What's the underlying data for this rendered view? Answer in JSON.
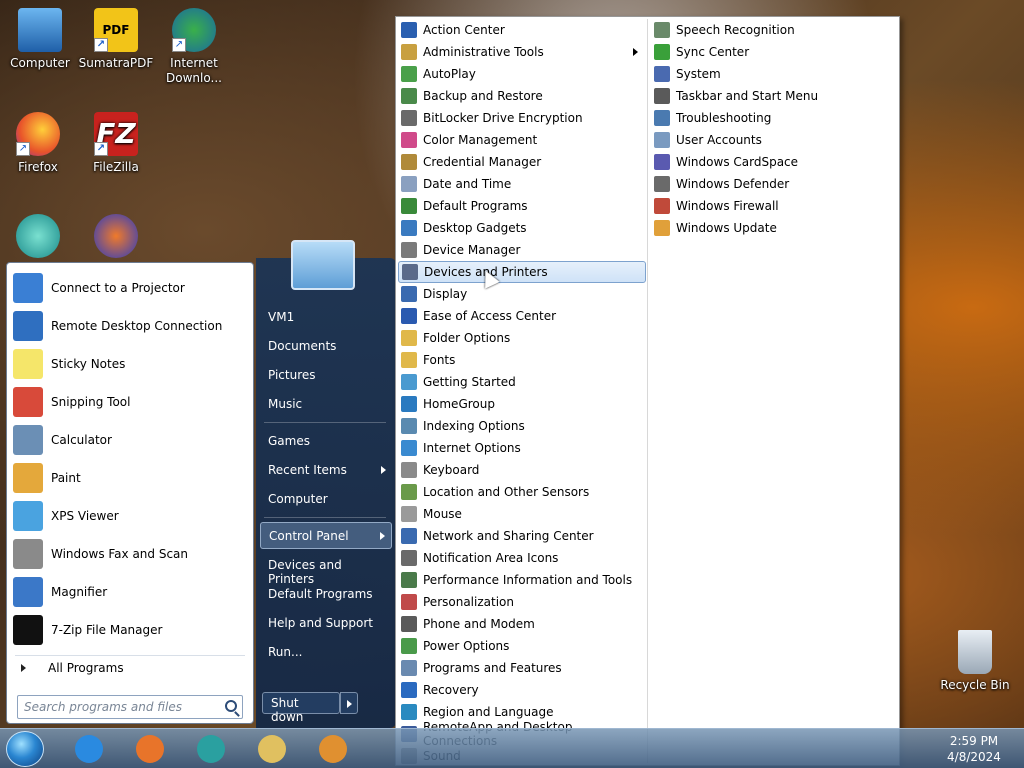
{
  "desktop": {
    "icons": [
      {
        "label": "Computer",
        "icon": "computer-icon"
      },
      {
        "label": "SumatraPDF",
        "icon": "pdf-icon"
      },
      {
        "label": "Internet Downlo...",
        "icon": "download-manager-icon"
      },
      {
        "label": "Firefox",
        "icon": "firefox-icon"
      },
      {
        "label": "FileZilla",
        "icon": "filezilla-icon"
      },
      {
        "label": "",
        "icon": "app-icon"
      },
      {
        "label": "",
        "icon": "audio-icon"
      },
      {
        "label": "Recycle Bin",
        "icon": "recycle-bin-icon"
      }
    ]
  },
  "start_menu": {
    "programs": [
      {
        "label": "Connect to a Projector",
        "icon": "projector-icon",
        "color": "#3a7fd4"
      },
      {
        "label": "Remote Desktop Connection",
        "icon": "remote-desktop-icon",
        "color": "#2f6fc0"
      },
      {
        "label": "Sticky Notes",
        "icon": "sticky-notes-icon",
        "color": "#f5e66a"
      },
      {
        "label": "Snipping Tool",
        "icon": "snipping-tool-icon",
        "color": "#d84a3a"
      },
      {
        "label": "Calculator",
        "icon": "calculator-icon",
        "color": "#6b8fb5"
      },
      {
        "label": "Paint",
        "icon": "paint-icon",
        "color": "#e4a83b"
      },
      {
        "label": "XPS Viewer",
        "icon": "xps-viewer-icon",
        "color": "#4aa3e0"
      },
      {
        "label": "Windows Fax and Scan",
        "icon": "fax-scan-icon",
        "color": "#8a8a8a"
      },
      {
        "label": "Magnifier",
        "icon": "magnifier-icon",
        "color": "#3b78c8"
      },
      {
        "label": "7-Zip File Manager",
        "icon": "7zip-icon",
        "color": "#111111"
      }
    ],
    "all_programs": "All Programs",
    "search_placeholder": "Search programs and files",
    "places": [
      {
        "label": "VM1",
        "submenu": false
      },
      {
        "label": "Documents",
        "submenu": false
      },
      {
        "label": "Pictures",
        "submenu": false
      },
      {
        "label": "Music",
        "submenu": false
      },
      {
        "label": "Games",
        "submenu": false
      },
      {
        "label": "Recent Items",
        "submenu": true
      },
      {
        "label": "Computer",
        "submenu": false
      },
      {
        "label": "Control Panel",
        "submenu": true,
        "highlighted": true
      },
      {
        "label": "Devices and Printers",
        "submenu": false
      },
      {
        "label": "Default Programs",
        "submenu": false
      },
      {
        "label": "Help and Support",
        "submenu": false
      },
      {
        "label": "Run...",
        "submenu": false
      }
    ],
    "shutdown": "Shut down"
  },
  "control_panel_menu": {
    "column1": [
      {
        "label": "Action Center",
        "color": "#2a5fb0"
      },
      {
        "label": "Administrative Tools",
        "color": "#c8a040",
        "submenu": true
      },
      {
        "label": "AutoPlay",
        "color": "#4aa04a"
      },
      {
        "label": "Backup and Restore",
        "color": "#4a8a4a"
      },
      {
        "label": "BitLocker Drive Encryption",
        "color": "#6a6a6a"
      },
      {
        "label": "Color Management",
        "color": "#d04a8a"
      },
      {
        "label": "Credential Manager",
        "color": "#b08a3a"
      },
      {
        "label": "Date and Time",
        "color": "#8aa0c0"
      },
      {
        "label": "Default Programs",
        "color": "#3a8a3a"
      },
      {
        "label": "Desktop Gadgets",
        "color": "#3a7ac0"
      },
      {
        "label": "Device Manager",
        "color": "#7a7a7a"
      },
      {
        "label": "Devices and Printers",
        "color": "#5a6a8a",
        "highlighted": true
      },
      {
        "label": "Display",
        "color": "#3a6ab0"
      },
      {
        "label": "Ease of Access Center",
        "color": "#2a5ab0"
      },
      {
        "label": "Folder Options",
        "color": "#e0b84a"
      },
      {
        "label": "Fonts",
        "color": "#e0b84a"
      },
      {
        "label": "Getting Started",
        "color": "#4a9ad0"
      },
      {
        "label": "HomeGroup",
        "color": "#2a7ac0"
      },
      {
        "label": "Indexing Options",
        "color": "#5a8ab0"
      },
      {
        "label": "Internet Options",
        "color": "#3a8ad0"
      },
      {
        "label": "Keyboard",
        "color": "#8a8a8a"
      },
      {
        "label": "Location and Other Sensors",
        "color": "#6a9a4a"
      },
      {
        "label": "Mouse",
        "color": "#9a9a9a"
      },
      {
        "label": "Network and Sharing Center",
        "color": "#3a6ab0"
      },
      {
        "label": "Notification Area Icons",
        "color": "#6a6a6a"
      },
      {
        "label": "Performance Information and Tools",
        "color": "#4a7a4a"
      },
      {
        "label": "Personalization",
        "color": "#c04a4a"
      },
      {
        "label": "Phone and Modem",
        "color": "#5a5a5a"
      },
      {
        "label": "Power Options",
        "color": "#4a9a4a"
      },
      {
        "label": "Programs and Features",
        "color": "#6a8ab0"
      },
      {
        "label": "Recovery",
        "color": "#2a6ac0"
      },
      {
        "label": "Region and Language",
        "color": "#2a8ac0"
      },
      {
        "label": "RemoteApp and Desktop Connections",
        "color": "#3a5a9a"
      },
      {
        "label": "Sound",
        "color": "#8a8a8a"
      }
    ],
    "column2": [
      {
        "label": "Speech Recognition",
        "color": "#6a8a6a"
      },
      {
        "label": "Sync Center",
        "color": "#3aa03a"
      },
      {
        "label": "System",
        "color": "#4a6ab0"
      },
      {
        "label": "Taskbar and Start Menu",
        "color": "#5a5a5a"
      },
      {
        "label": "Troubleshooting",
        "color": "#4a7ab0"
      },
      {
        "label": "User Accounts",
        "color": "#7a9ac0"
      },
      {
        "label": "Windows CardSpace",
        "color": "#5a5ab0"
      },
      {
        "label": "Windows Defender",
        "color": "#6a6a6a"
      },
      {
        "label": "Windows Firewall",
        "color": "#c04a3a"
      },
      {
        "label": "Windows Update",
        "color": "#e0a03a"
      }
    ]
  },
  "taskbar": {
    "buttons": [
      {
        "name": "internet-explorer-icon",
        "color": "#2a8ae0"
      },
      {
        "name": "firefox-icon",
        "color": "#e8742a"
      },
      {
        "name": "app-icon",
        "color": "#2aa0a0"
      },
      {
        "name": "file-explorer-icon",
        "color": "#e0c060"
      },
      {
        "name": "media-player-icon",
        "color": "#e09030"
      }
    ],
    "time": "2:59 PM",
    "date": "4/8/2024"
  }
}
